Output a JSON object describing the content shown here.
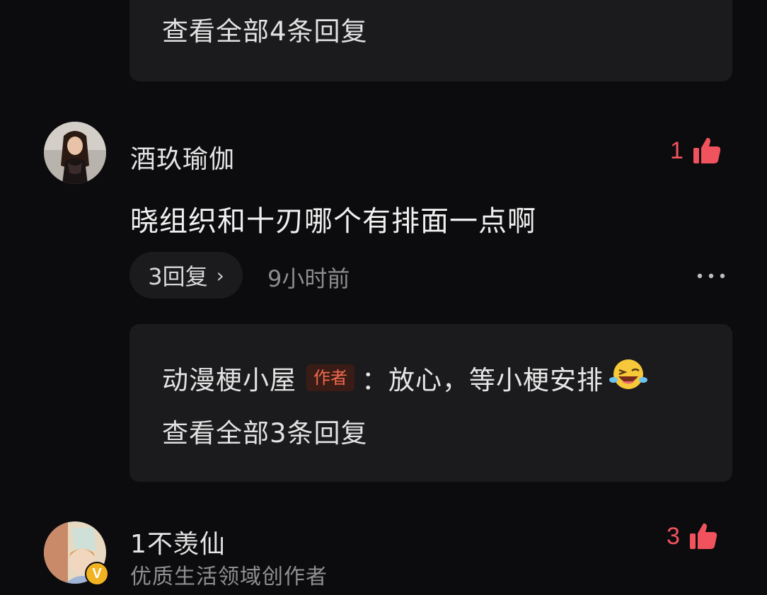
{
  "top_reply_block": {
    "view_all_label": "查看全部4条回复"
  },
  "comment1": {
    "username": "酒玖瑜伽",
    "likes": "1",
    "text": "晓组织和十刃哪个有排面一点啊",
    "reply_count_label": "3回复",
    "time": "9小时前",
    "more_icon": "more-dots-icon",
    "sub_reply": {
      "author": "动漫梗小屋",
      "badge": "作者",
      "text": "：放心，等小梗安排",
      "emoji_icon": "laughing-wink-emoji-icon"
    },
    "view_all_label": "查看全部3条回复"
  },
  "comment2": {
    "username": "1不羡仙",
    "likes": "3",
    "subtitle": "优质生活领域创作者",
    "verified_badge": "V"
  },
  "colors": {
    "background": "#0c0c0e",
    "card": "#1b1b1d",
    "like_red": "#f0535d",
    "author_badge_bg": "#3a1c16",
    "author_badge_text": "#f0694f",
    "verified_gold": "#f2b320"
  }
}
